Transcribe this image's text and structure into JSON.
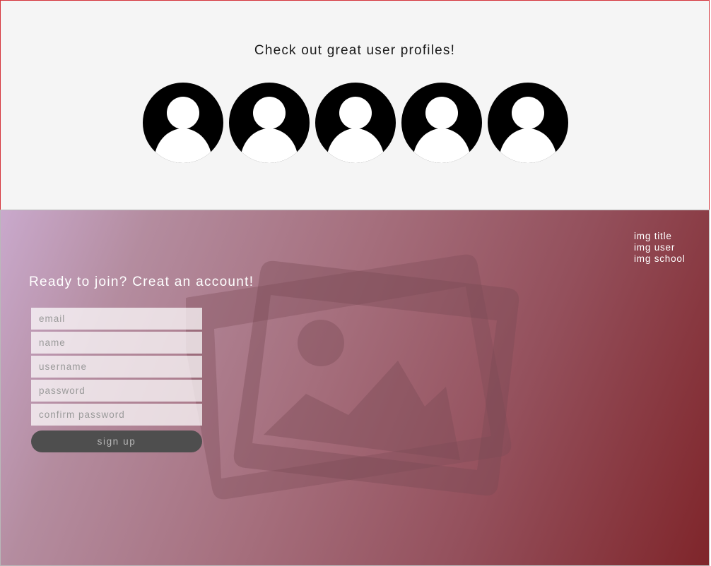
{
  "profiles": {
    "heading": "Check out great user profiles!",
    "avatars": [
      {
        "icon": "user-avatar-icon"
      },
      {
        "icon": "user-avatar-icon"
      },
      {
        "icon": "user-avatar-icon"
      },
      {
        "icon": "user-avatar-icon"
      },
      {
        "icon": "user-avatar-icon"
      }
    ]
  },
  "hero": {
    "background_icon": "image-placeholder-icon",
    "meta": {
      "title": "img title",
      "user": "img user",
      "school": "img school"
    }
  },
  "signup": {
    "heading": "Ready to join? Creat an account!",
    "fields": {
      "email_placeholder": "email",
      "name_placeholder": "name",
      "username_placeholder": "username",
      "password_placeholder": "password",
      "confirm_password_placeholder": "confirm password"
    },
    "button_label": "sign up"
  },
  "colors": {
    "top_border": "#d4333a",
    "top_background": "#f5f5f5",
    "gradient_start": "#c9a9cc",
    "gradient_end": "#7f252a",
    "button_background": "#4e4e4e"
  }
}
